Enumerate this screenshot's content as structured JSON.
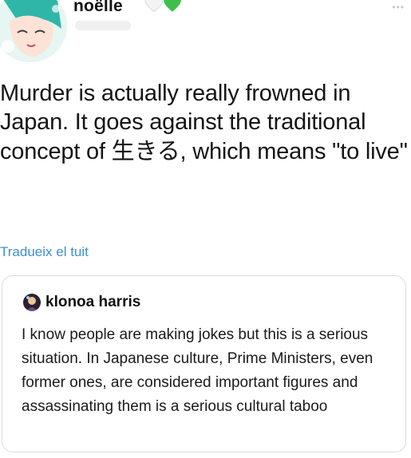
{
  "post": {
    "author_name": "noëlle",
    "author_badges": [
      "white-heart-icon",
      "green-heart-icon"
    ],
    "text": "Murder is actually really frowned in Japan. It goes against the traditional concept of ",
    "text_japanese": "生きる",
    "text_end": ", which means \"to live\"",
    "translate_label": "Tradueix el tuit"
  },
  "quoted": {
    "author_name": "klonoa harris",
    "text": "I know people are making jokes but this is a serious situation. In Japanese culture, Prime Ministers, even former ones, are considered important figures and assassinating them is a serious cultural taboo"
  },
  "colors": {
    "link": "#3a8fd8",
    "text": "#141414",
    "border": "#d9dde1"
  }
}
